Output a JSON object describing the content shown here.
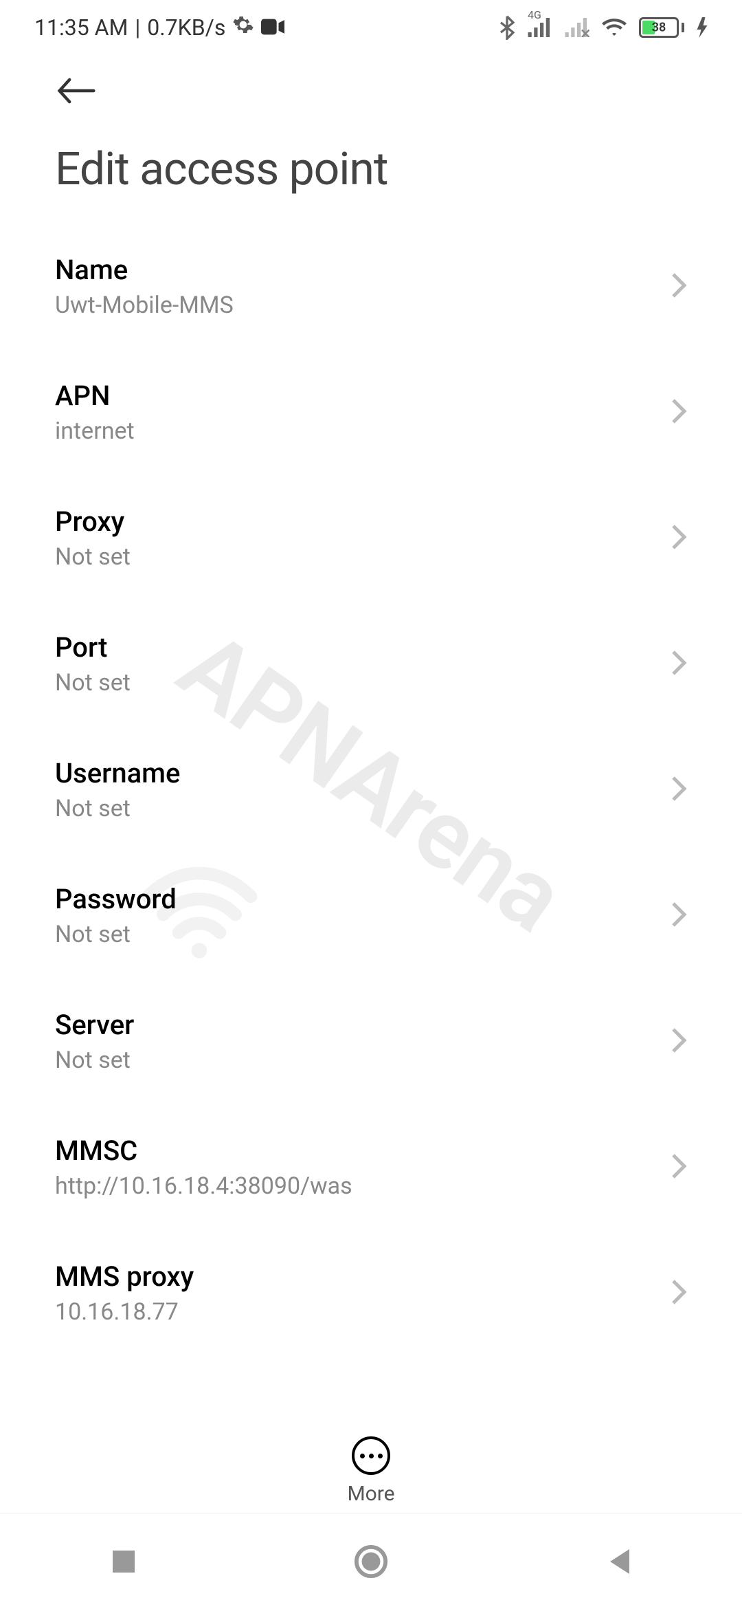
{
  "status_bar": {
    "time": "11:35 AM",
    "separator": "|",
    "data_rate": "0.7KB/s",
    "battery_percent": "38",
    "network_label": "4G"
  },
  "header": {
    "title": "Edit access point"
  },
  "settings": [
    {
      "label": "Name",
      "value": "Uwt-Mobile-MMS"
    },
    {
      "label": "APN",
      "value": "internet"
    },
    {
      "label": "Proxy",
      "value": "Not set"
    },
    {
      "label": "Port",
      "value": "Not set"
    },
    {
      "label": "Username",
      "value": "Not set"
    },
    {
      "label": "Password",
      "value": "Not set"
    },
    {
      "label": "Server",
      "value": "Not set"
    },
    {
      "label": "MMSC",
      "value": "http://10.16.18.4:38090/was"
    },
    {
      "label": "MMS proxy",
      "value": "10.16.18.77"
    }
  ],
  "bottom": {
    "more_label": "More"
  },
  "watermark": {
    "text": "APNArena"
  }
}
